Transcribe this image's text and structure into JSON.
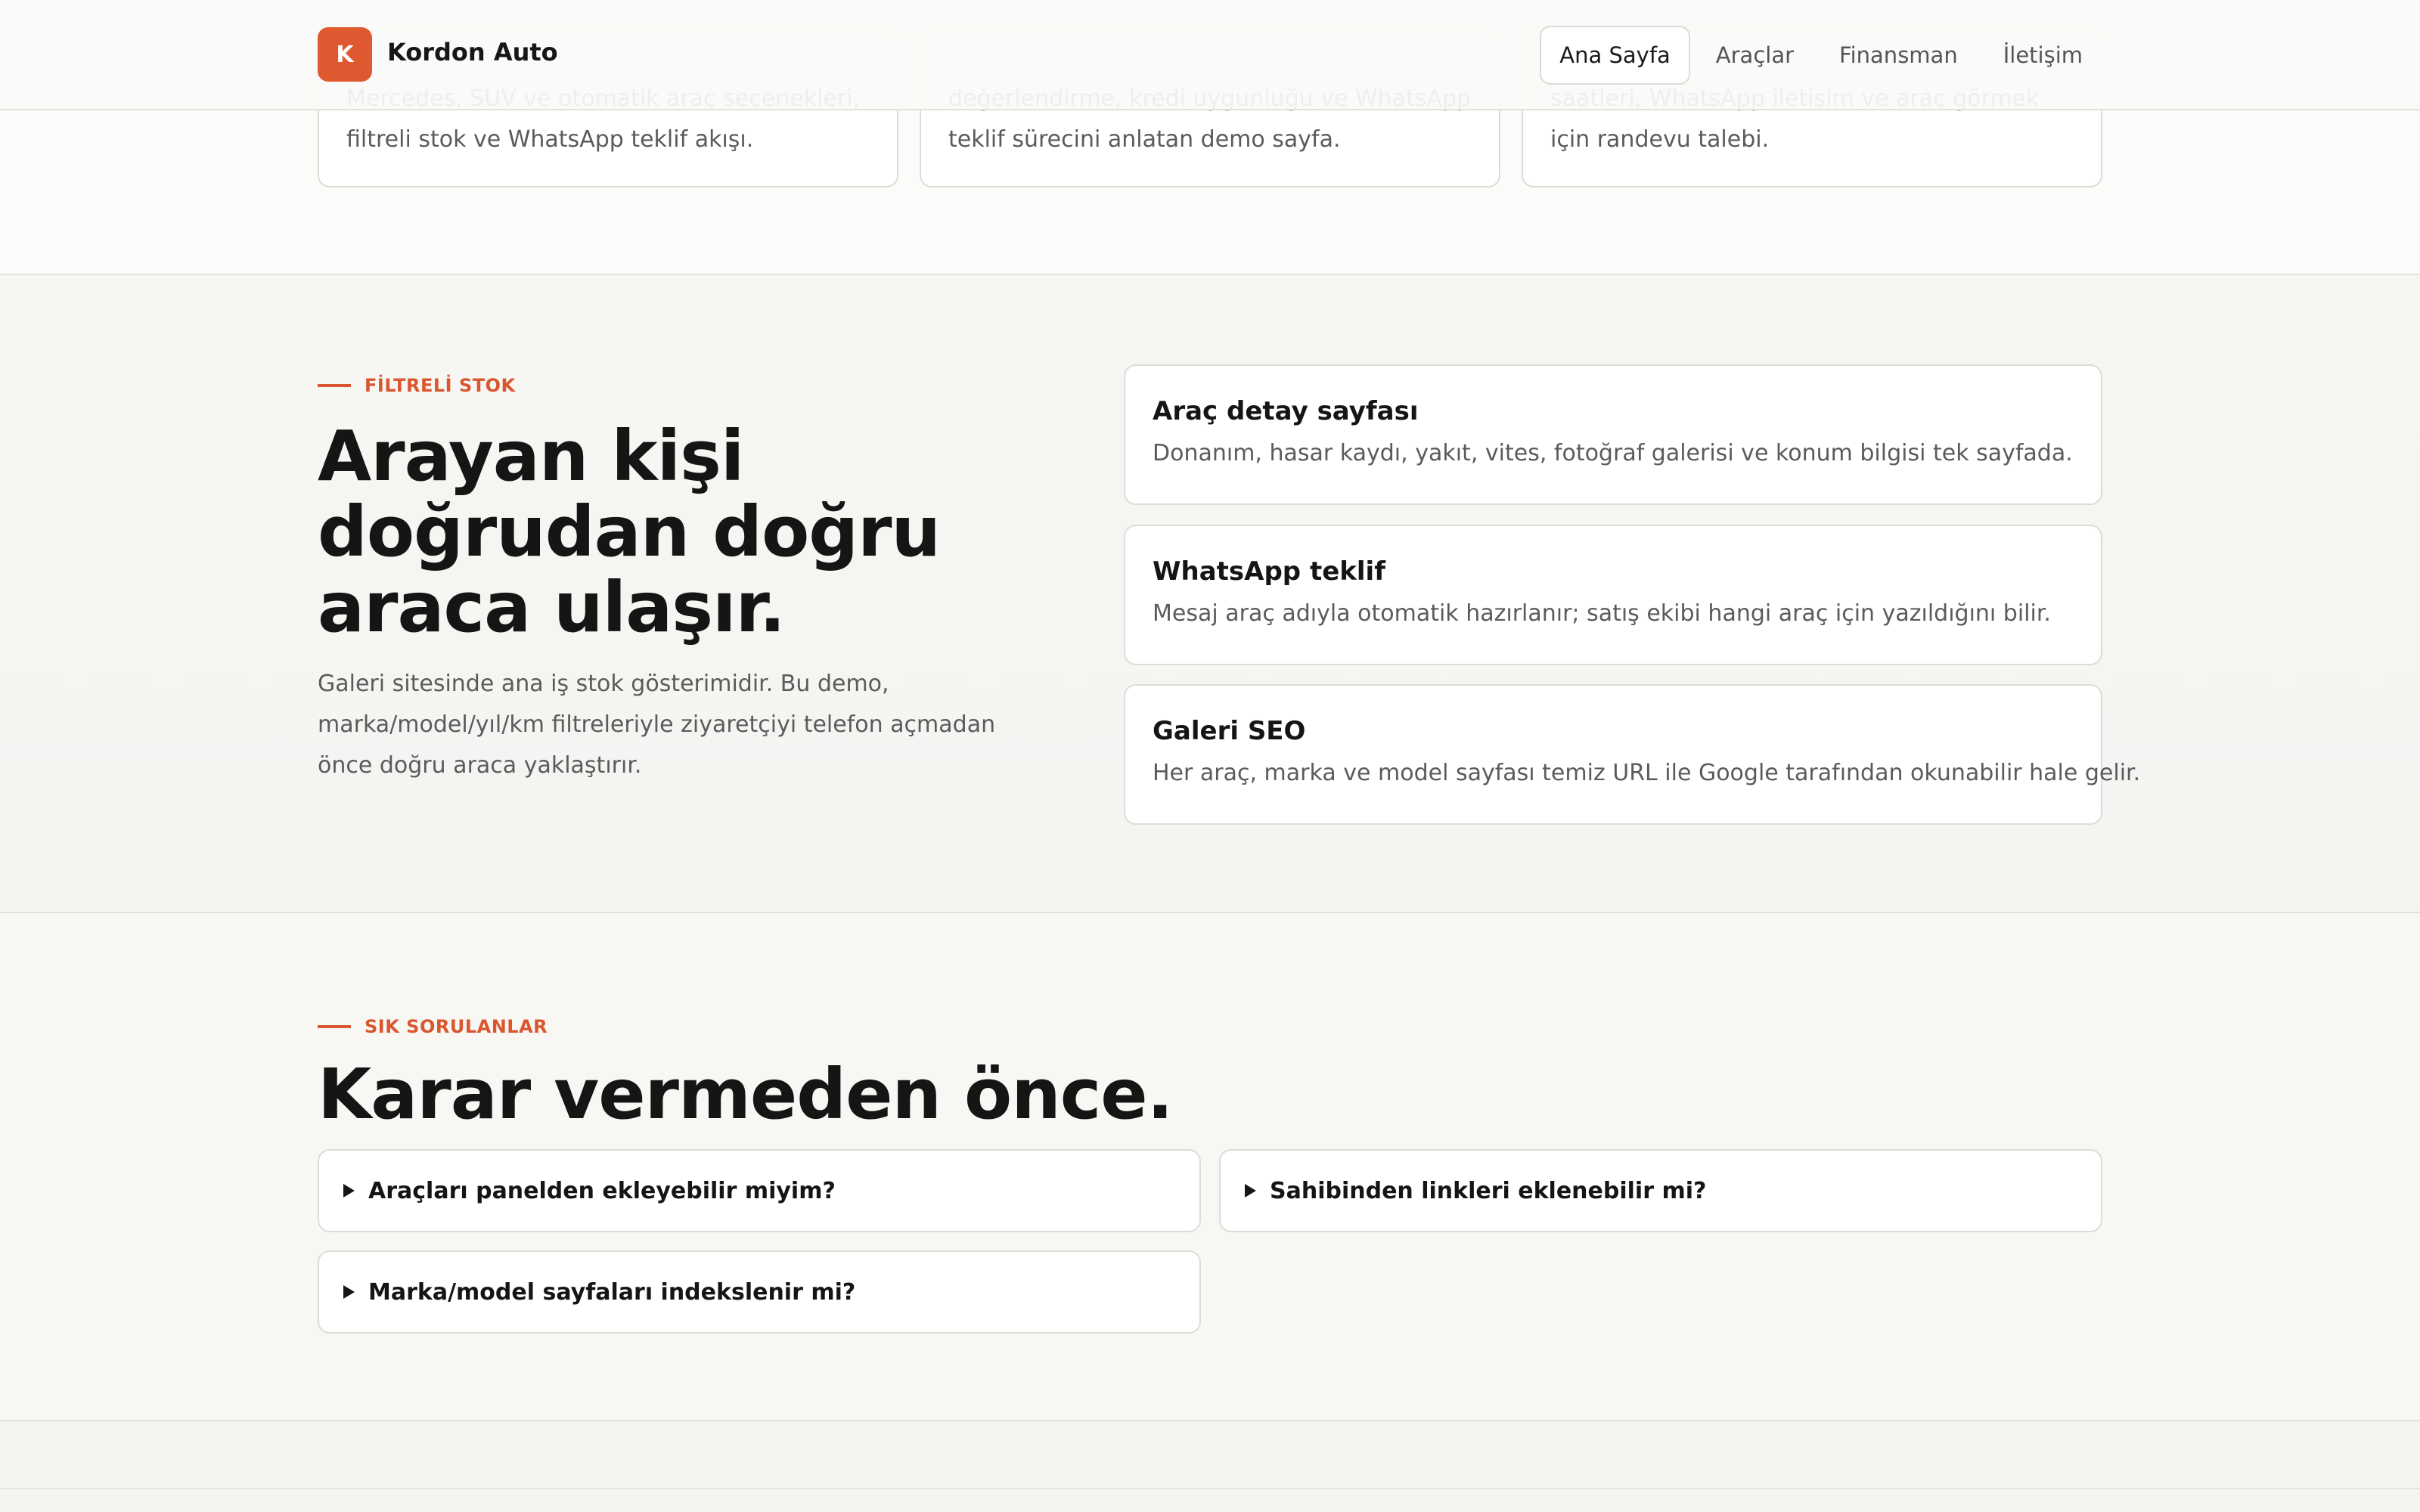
{
  "brand": {
    "logo_letter": "K",
    "name": "Kordon Auto"
  },
  "nav": {
    "items": [
      {
        "label": "Ana Sayfa",
        "active": true
      },
      {
        "label": "Araçlar",
        "active": false
      },
      {
        "label": "Finansman",
        "active": false
      },
      {
        "label": "İletişim",
        "active": false
      }
    ]
  },
  "top_cards": [
    {
      "text": "Mercedes, SUV ve otomatik araç seçenekleri, filtreli stok ve WhatsApp teklif akışı."
    },
    {
      "text": "değerlendirme, kredi uygunluğu ve WhatsApp teklif sürecini anlatan demo sayfa."
    },
    {
      "text": "saatleri, WhatsApp iletişim ve araç görmek için randevu talebi."
    }
  ],
  "features": {
    "eyebrow": "FİLTRELİ STOK",
    "title": "Arayan kişi doğrudan doğru araca ulaşır.",
    "description": "Galeri sitesinde ana iş stok gösterimidir. Bu demo, marka/model/yıl/km filtreleriyle ziyaretçiyi telefon açmadan önce doğru araca yaklaştırır.",
    "cards": [
      {
        "title": "Araç detay sayfası",
        "text": "Donanım, hasar kaydı, yakıt, vites, fotoğraf galerisi ve konum bilgisi tek sayfada."
      },
      {
        "title": "WhatsApp teklif",
        "text": "Mesaj araç adıyla otomatik hazırlanır; satış ekibi hangi araç için yazıldığını bilir."
      },
      {
        "title": "Galeri SEO",
        "text": "Her araç, marka ve model sayfası temiz URL ile Google tarafından okunabilir hale gelir."
      }
    ]
  },
  "faq": {
    "eyebrow": "SIK SORULANLAR",
    "title": "Karar vermeden önce.",
    "items": [
      {
        "question": "Araçları panelden ekleyebilir miyim?"
      },
      {
        "question": "Sahibinden linkleri eklenebilir mi?"
      },
      {
        "question": "Marka/model sayfaları indekslenir mi?"
      }
    ]
  },
  "colors": {
    "accent": "#e0582f",
    "text": "#151515",
    "muted": "#5b5b5b",
    "background": "#f7f6f3"
  }
}
